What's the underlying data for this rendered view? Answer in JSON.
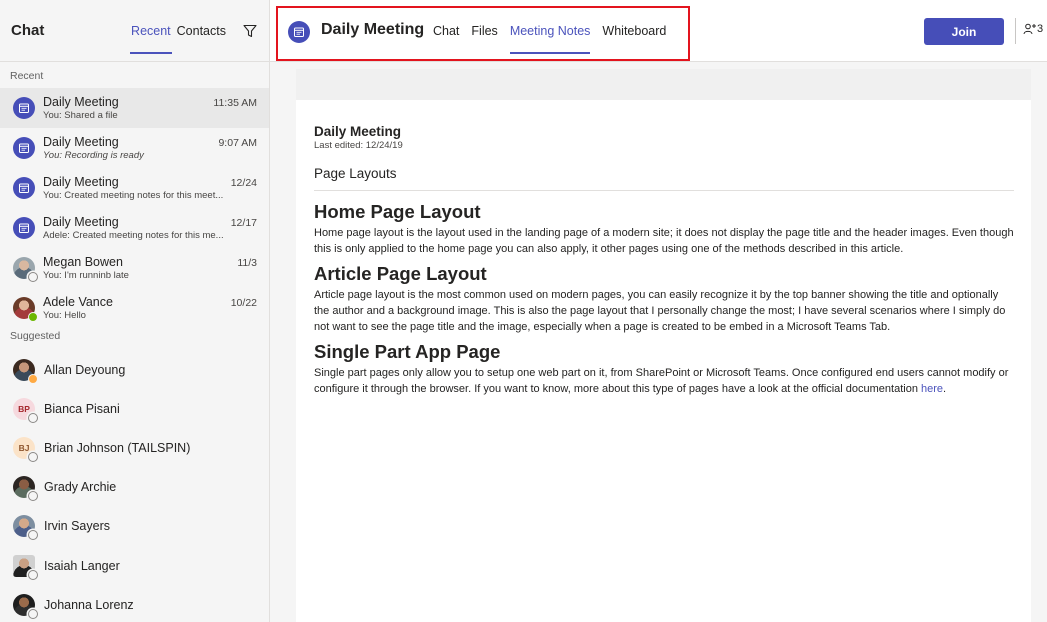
{
  "sidebar": {
    "title": "Chat",
    "tabs": [
      {
        "label": "Recent",
        "active": true
      },
      {
        "label": "Contacts",
        "active": false
      }
    ],
    "filter_icon": "filter-icon",
    "recent_label": "Recent",
    "recent": [
      {
        "name": "Daily Meeting",
        "time": "11:35 AM",
        "preview": "You: Shared a file",
        "avatar": "meeting-icon",
        "selected": true
      },
      {
        "name": "Daily Meeting",
        "time": "9:07 AM",
        "preview": "You: Recording is ready",
        "avatar": "meeting-icon",
        "selected": false
      },
      {
        "name": "Daily Meeting",
        "time": "12/24",
        "preview": "You: Created meeting notes for this meet...",
        "avatar": "meeting-icon",
        "selected": false
      },
      {
        "name": "Daily Meeting",
        "time": "12/17",
        "preview": "Adele: Created meeting notes for this me...",
        "avatar": "meeting-icon",
        "selected": false
      },
      {
        "name": "Megan Bowen",
        "time": "11/3",
        "preview": "You: I'm runninb late",
        "avatar": "photo",
        "selected": false
      },
      {
        "name": "Adele Vance",
        "time": "10/22",
        "preview": "You: Hello",
        "avatar": "photo",
        "selected": false
      }
    ],
    "suggested_label": "Suggested",
    "suggested": [
      {
        "name": "Allan Deyoung"
      },
      {
        "name": "Bianca Pisani",
        "initials": "BP"
      },
      {
        "name": "Brian Johnson (TAILSPIN)",
        "initials": "BJ"
      },
      {
        "name": "Grady Archie"
      },
      {
        "name": "Irvin Sayers"
      },
      {
        "name": "Isaiah Langer"
      },
      {
        "name": "Johanna Lorenz"
      }
    ]
  },
  "topbar": {
    "title": "Daily Meeting",
    "tabs": [
      {
        "label": "Chat",
        "active": false
      },
      {
        "label": "Files",
        "active": false
      },
      {
        "label": "Meeting Notes",
        "active": true
      },
      {
        "label": "Whiteboard",
        "active": false
      }
    ],
    "join_label": "Join",
    "people_count": "3",
    "highlight_color": "#e3141e"
  },
  "document": {
    "title": "Daily Meeting",
    "last_edited": "Last edited: 12/24/19",
    "section_title": "Page Layouts",
    "sections": [
      {
        "heading": "Home Page Layout",
        "body": "Home page layout is the layout used in the landing page of a modern site; it does not display the page title and the header images. Even though this is only applied to the home page you can also apply, it other pages using one of the methods described in this article."
      },
      {
        "heading": "Article Page Layout",
        "body": "Article page layout is the most common used on modern pages, you can easily recognize it by the top banner showing the title and optionally the author and a background image. This is also the page layout that I personally change the most; I have several scenarios where I simply do not want to see the page title and the image, especially when a page is created to be embed in a Microsoft Teams Tab."
      },
      {
        "heading": "Single Part App Page",
        "body": "Single part pages only allow you to setup one web part on it, from SharePoint or Microsoft Teams. Once configured end users cannot modify or configure it through the browser. If you want to know, more about this type of pages have a look at the official documentation ",
        "link_text": "here",
        "after_link": "."
      }
    ]
  },
  "colors": {
    "accent": "#464eb8",
    "accent_text": "#4b53bc",
    "sidebar_bg": "#f5f5f5"
  }
}
